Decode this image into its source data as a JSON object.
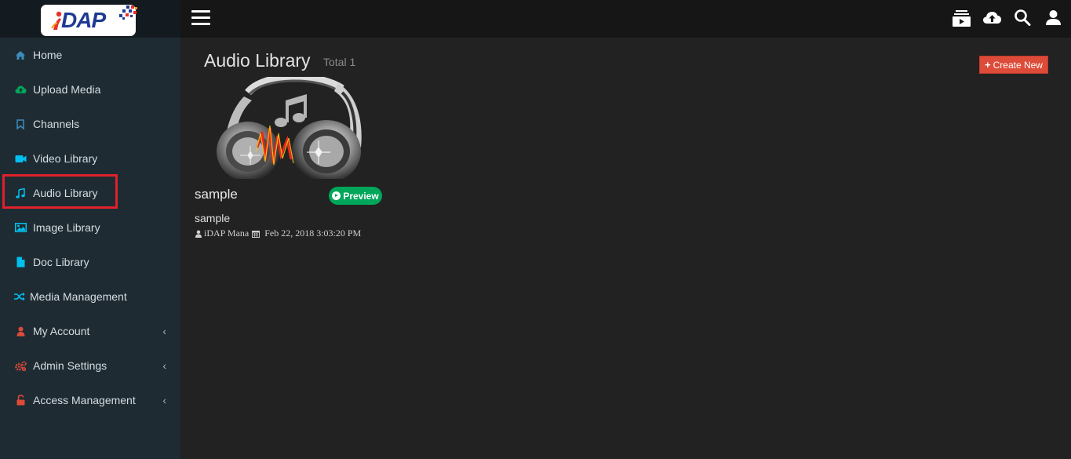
{
  "brand": {
    "logo_text": "DAP"
  },
  "topbar": {
    "icons": [
      "playlist-icon",
      "cloud-upload-icon",
      "search-icon",
      "user-icon"
    ]
  },
  "sidebar": {
    "items": [
      {
        "label": "Home",
        "icon": "home-icon",
        "color": "#3c8dbc"
      },
      {
        "label": "Upload Media",
        "icon": "cloud-upload-icon",
        "color": "#00a65a"
      },
      {
        "label": "Channels",
        "icon": "bookmark-icon",
        "color": "#3c8dbc"
      },
      {
        "label": "Video Library",
        "icon": "video-camera-icon",
        "color": "#00c0ef"
      },
      {
        "label": "Audio Library",
        "icon": "music-icon",
        "color": "#00c0ef"
      },
      {
        "label": "Image Library",
        "icon": "image-icon",
        "color": "#00c0ef"
      },
      {
        "label": "Doc Library",
        "icon": "document-icon",
        "color": "#00c0ef"
      },
      {
        "label": "Media Management",
        "icon": "random-icon",
        "color": "#00c0ef"
      },
      {
        "label": "My Account",
        "icon": "user-icon",
        "color": "#dd4b39",
        "caret": "‹"
      },
      {
        "label": "Admin Settings",
        "icon": "cogs-icon",
        "color": "#dd4b39",
        "caret": "‹"
      },
      {
        "label": "Access Management",
        "icon": "unlock-icon",
        "color": "#dd4b39",
        "caret": "‹"
      }
    ],
    "active": "Audio Library"
  },
  "main": {
    "title": "Audio Library",
    "subtitle": "Total 1",
    "create_label": "Create New",
    "items": [
      {
        "title": "sample",
        "preview_label": "Preview",
        "description": "sample",
        "owner": "iDAP Mana",
        "date": "Feb 22, 2018 3:03:20 PM"
      }
    ]
  },
  "colors": {
    "accent_red": "#dd4b39",
    "accent_green": "#00a65a",
    "highlight": "#e0202a",
    "sidebar_bg": "#1e2b33",
    "main_bg": "#222222"
  }
}
